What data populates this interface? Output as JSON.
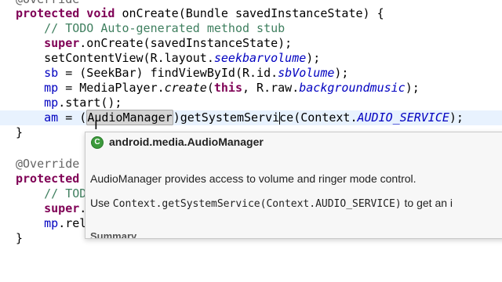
{
  "editor": {
    "lines": {
      "l0": "@Override",
      "l1_kw": "protected void",
      "l1_rest": " onCreate(Bundle savedInstanceState) {",
      "l2": "// TODO Auto-generated method stub",
      "l3_kw": "super",
      "l3_rest": ".onCreate(savedInstanceState);",
      "l4_a": "setContentView(R.layout.",
      "l4_fld": "seekbarvolume",
      "l4_b": ");",
      "l5_a": "sb",
      "l5_b": " = (SeekBar) findViewById(R.id.",
      "l5_fld": "sbVolume",
      "l5_c": ");",
      "l6_a": "mp",
      "l6_b": " = MediaPlayer.",
      "l6_st": "create",
      "l6_c": "(",
      "l6_kw": "this",
      "l6_d": ", R.raw.",
      "l6_fld": "backgroundmusic",
      "l6_e": ");",
      "l7_a": "mp",
      "l7_b": ".start();",
      "l8_a": "am",
      "l8_b": " = (",
      "l8_hl": "AudioManager",
      "l8_c": ")getSystemServi",
      "l8_d": "ce(Context.",
      "l8_fld": "AUDIO_SERVICE",
      "l8_e": ");",
      "l9": "}",
      "l11": "@Override",
      "l12": "protected",
      "l13_cm": "// TODO",
      "l14_kw": "super",
      "l14_rest": ".",
      "l15_a": "mp",
      "l15_b": ".rel",
      "l16": "}"
    }
  },
  "popup": {
    "class_icon": "C",
    "title": "android.media.AudioManager",
    "description": "AudioManager provides access to volume and ringer mode control.",
    "use_prefix": "Use ",
    "use_code": "Context.getSystemService(Context.AUDIO_SERVICE)",
    "use_suffix": " to get an i",
    "summary": "Summary"
  },
  "colors": {
    "keyword": "#7f0055",
    "comment": "#3f7f5f",
    "field": "#0000c0",
    "current_line": "#e8f2fe"
  }
}
